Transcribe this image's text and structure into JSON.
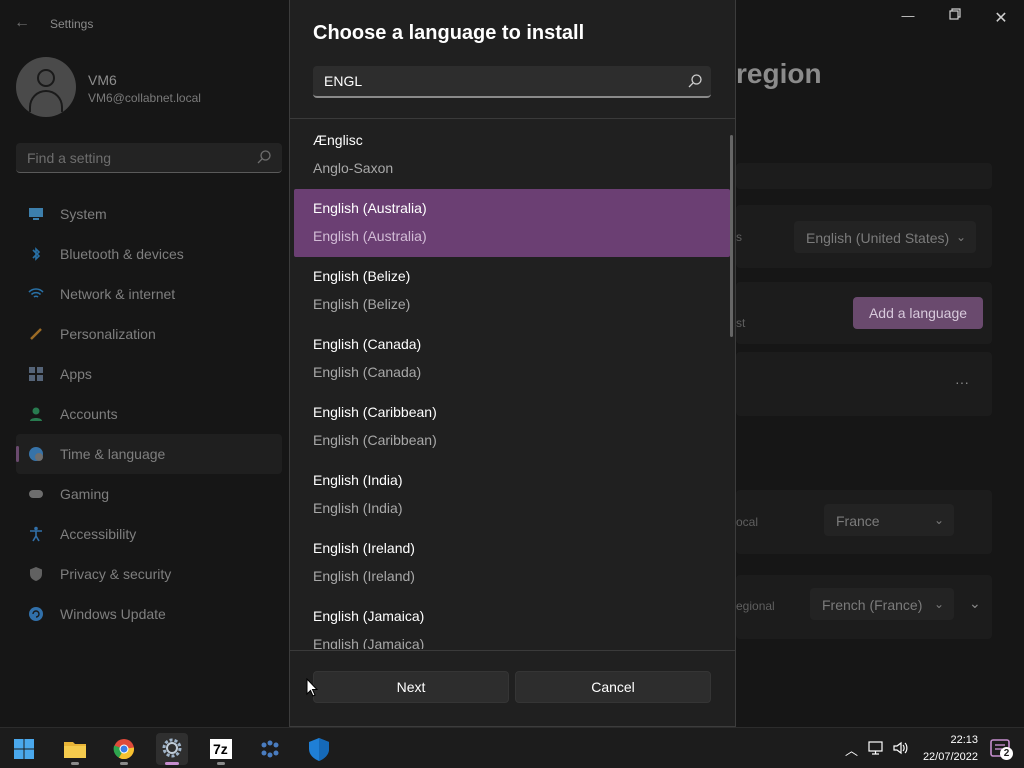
{
  "settings": {
    "app_title": "Settings",
    "user": {
      "name": "VM6",
      "email": "VM6@collabnet.local"
    },
    "search_placeholder": "Find a setting",
    "nav": [
      {
        "label": "System",
        "icon": "monitor-icon",
        "color": "#4aa3df"
      },
      {
        "label": "Bluetooth & devices",
        "icon": "bluetooth-icon",
        "color": "#2f8fd6"
      },
      {
        "label": "Network & internet",
        "icon": "wifi-icon",
        "color": "#2f8fd6"
      },
      {
        "label": "Personalization",
        "icon": "brush-icon",
        "color": "#c9882a"
      },
      {
        "label": "Apps",
        "icon": "apps-icon",
        "color": "#6b7f99"
      },
      {
        "label": "Accounts",
        "icon": "person-icon",
        "color": "#2f9d63"
      },
      {
        "label": "Time & language",
        "icon": "globe-clock-icon",
        "color": "#3f8fd6"
      },
      {
        "label": "Gaming",
        "icon": "gamepad-icon",
        "color": "#8a8a8a"
      },
      {
        "label": "Accessibility",
        "icon": "accessibility-icon",
        "color": "#3b8fdc"
      },
      {
        "label": "Privacy & security",
        "icon": "shield-icon",
        "color": "#7a7a7a"
      },
      {
        "label": "Windows Update",
        "icon": "update-icon",
        "color": "#3a8fdc"
      }
    ],
    "active_nav_index": 6,
    "page_title_partial": "region",
    "bg_language_value": "English (United States)",
    "add_language_label": "Add a language",
    "more_label": "···",
    "country_label": "ocal",
    "country_value": "France",
    "regional_label": "egional",
    "regional_value": "French (France)",
    "partial_s": "s",
    "partial_st": "st"
  },
  "dialog": {
    "title": "Choose a language to install",
    "search_value": "ENGL",
    "languages": [
      {
        "native": "Ænglisc",
        "english": "Anglo-Saxon"
      },
      {
        "native": "English (Australia)",
        "english": "English (Australia)"
      },
      {
        "native": "English (Belize)",
        "english": "English (Belize)"
      },
      {
        "native": "English (Canada)",
        "english": "English (Canada)"
      },
      {
        "native": "English (Caribbean)",
        "english": "English (Caribbean)"
      },
      {
        "native": "English (India)",
        "english": "English (India)"
      },
      {
        "native": "English (Ireland)",
        "english": "English (Ireland)"
      },
      {
        "native": "English (Jamaica)",
        "english": "English (Jamaica)"
      }
    ],
    "selected_index": 1,
    "next_label": "Next",
    "cancel_label": "Cancel"
  },
  "taskbar": {
    "apps": [
      {
        "name": "start",
        "icon": "windows-start-icon"
      },
      {
        "name": "file-explorer",
        "icon": "folder-icon"
      },
      {
        "name": "chrome",
        "icon": "chrome-icon"
      },
      {
        "name": "settings",
        "icon": "gear-icon"
      },
      {
        "name": "7zip",
        "icon": "7zip-icon",
        "text": "7z"
      },
      {
        "name": "network-app",
        "icon": "network-grid-icon"
      },
      {
        "name": "security-app",
        "icon": "shield-icon"
      }
    ],
    "active_app": "settings",
    "time": "22:13",
    "date": "22/07/2022",
    "notification_count": "2"
  },
  "colors": {
    "accent": "#6b3f73",
    "accent_indicator": "#c68ecf"
  }
}
